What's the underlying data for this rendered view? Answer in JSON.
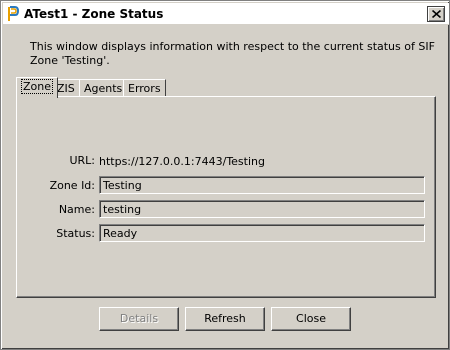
{
  "window": {
    "title": "ATest1 - Zone Status",
    "app_icon": "app-icon",
    "close_icon": "close-icon"
  },
  "description": "This window displays information with respect to the current status of SIF Zone 'Testing'.",
  "tabs": [
    {
      "label": "Zone",
      "active": true
    },
    {
      "label": "ZIS",
      "active": false
    },
    {
      "label": "Agents",
      "active": false
    },
    {
      "label": "Errors",
      "active": false
    }
  ],
  "zone": {
    "url_label": "URL:",
    "url_value": "https://127.0.0.1:7443/Testing",
    "zone_id_label": "Zone Id:",
    "zone_id_value": "Testing",
    "name_label": "Name:",
    "name_value": "testing",
    "status_label": "Status:",
    "status_value": "Ready"
  },
  "buttons": {
    "details": "Details",
    "refresh": "Refresh",
    "close": "Close"
  }
}
